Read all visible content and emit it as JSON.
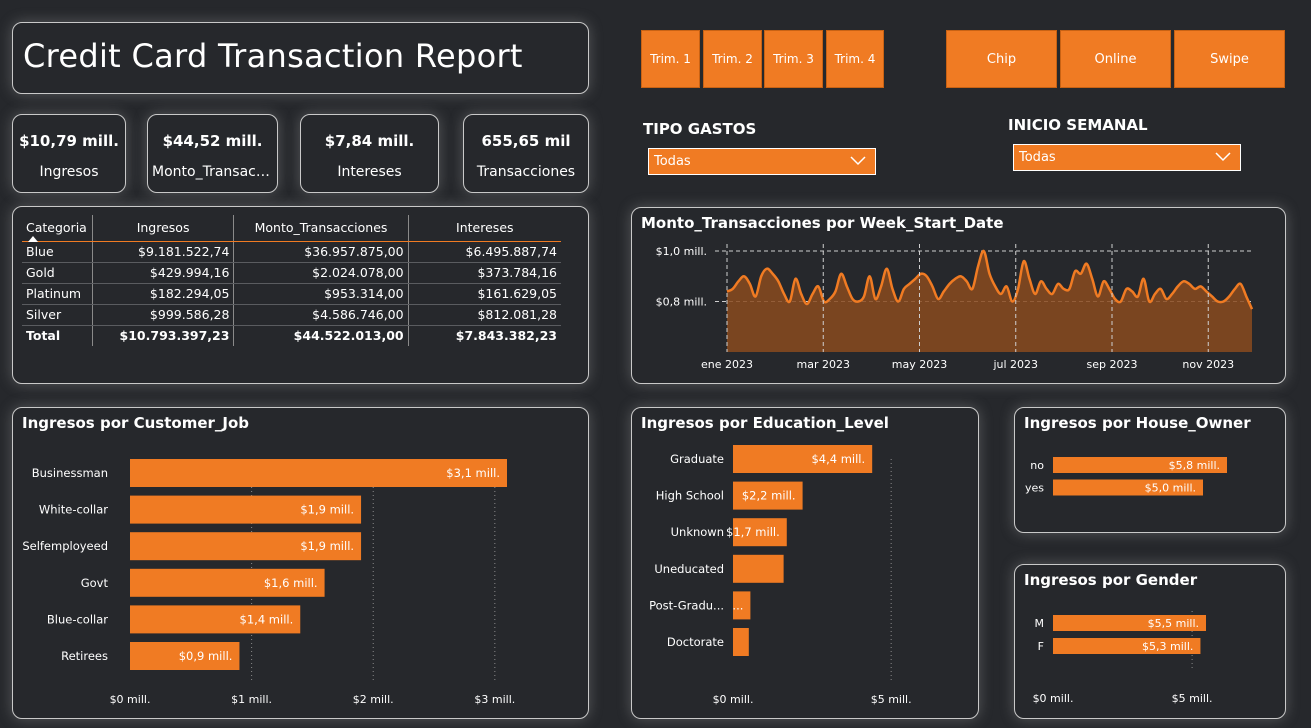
{
  "title": "Credit Card Transaction Report",
  "kpis": [
    {
      "value": "$10,79 mill.",
      "label": "Ingresos"
    },
    {
      "value": "$44,52 mill.",
      "label": "Monto_Transacciones"
    },
    {
      "value": "$7,84 mill.",
      "label": "Intereses"
    },
    {
      "value": "655,65 mil",
      "label": "Transacciones"
    }
  ],
  "quarter_buttons": [
    "Trim. 1",
    "Trim. 2",
    "Trim. 3",
    "Trim. 4"
  ],
  "channel_buttons": [
    "Chip",
    "Online",
    "Swipe"
  ],
  "accent": "#f07b23",
  "slicers": {
    "tipo_gastos": {
      "label": "TIPO GASTOS",
      "value": "Todas"
    },
    "inicio_semanal": {
      "label": "INICIO SEMANAL",
      "value": "Todas"
    }
  },
  "table": {
    "headers": [
      "Categoria",
      "Ingresos",
      "Monto_Transacciones",
      "Intereses"
    ],
    "rows": [
      [
        "Blue",
        "$9.181.522,74",
        "$36.957.875,00",
        "$6.495.887,74"
      ],
      [
        "Gold",
        "$429.994,16",
        "$2.024.078,00",
        "$373.784,16"
      ],
      [
        "Platinum",
        "$182.294,05",
        "$953.314,00",
        "$161.629,05"
      ],
      [
        "Silver",
        "$999.586,28",
        "$4.586.746,00",
        "$812.081,28"
      ]
    ],
    "total": [
      "Total",
      "$10.793.397,23",
      "$44.522.013,00",
      "$7.843.382,23"
    ]
  },
  "chart_data": [
    {
      "id": "weekly",
      "type": "area",
      "title": "Monto_Transacciones por Week_Start_Date",
      "y_ticks": [
        "$1,0 mill.",
        "$0,8 mill."
      ],
      "y_tick_values": [
        1.0,
        0.8
      ],
      "ylim": [
        0.6,
        1.02
      ],
      "x_ticks": [
        "ene 2023",
        "mar 2023",
        "may 2023",
        "jul 2023",
        "sep 2023",
        "nov 2023"
      ],
      "values": [
        0.84,
        0.85,
        0.88,
        0.9,
        0.87,
        0.82,
        0.9,
        0.93,
        0.91,
        0.88,
        0.83,
        0.8,
        0.89,
        0.83,
        0.79,
        0.83,
        0.86,
        0.8,
        0.81,
        0.84,
        0.91,
        0.86,
        0.81,
        0.8,
        0.82,
        0.9,
        0.81,
        0.86,
        0.93,
        0.85,
        0.8,
        0.85,
        0.87,
        0.89,
        0.91,
        0.9,
        0.86,
        0.81,
        0.84,
        0.87,
        0.89,
        0.9,
        0.88,
        0.85,
        0.94,
        1.0,
        0.91,
        0.86,
        0.83,
        0.86,
        0.8,
        0.85,
        0.96,
        0.89,
        0.83,
        0.88,
        0.85,
        0.83,
        0.87,
        0.85,
        0.85,
        0.92,
        0.91,
        0.95,
        0.89,
        0.82,
        0.88,
        0.85,
        0.81,
        0.8,
        0.85,
        0.84,
        0.82,
        0.89,
        0.8,
        0.83,
        0.85,
        0.81,
        0.83,
        0.86,
        0.88,
        0.87,
        0.85,
        0.86,
        0.84,
        0.82,
        0.8,
        0.8,
        0.82,
        0.85,
        0.87,
        0.82,
        0.77
      ]
    },
    {
      "id": "job",
      "type": "bar",
      "title": "Ingresos por Customer_Job",
      "categories": [
        "Businessman",
        "White-collar",
        "Selfemployeed",
        "Govt",
        "Blue-collar",
        "Retirees"
      ],
      "values": [
        3.1,
        1.9,
        1.9,
        1.6,
        1.4,
        0.9
      ],
      "labels": [
        "$3,1 mill.",
        "$1,9 mill.",
        "$1,9 mill.",
        "$1,6 mill.",
        "$1,4 mill.",
        "$0,9 mill."
      ],
      "x_ticks": [
        "$0 mill.",
        "$1 mill.",
        "$2 mill.",
        "$3 mill."
      ],
      "x_tick_values": [
        0,
        1,
        2,
        3
      ],
      "xlim": [
        0,
        3.1
      ]
    },
    {
      "id": "education",
      "type": "bar",
      "title": "Ingresos por Education_Level",
      "categories": [
        "Graduate",
        "High School",
        "Unknown",
        "Uneducated",
        "Post-Gradu...",
        "Doctorate"
      ],
      "values": [
        4.4,
        2.2,
        1.7,
        1.6,
        0.55,
        0.5
      ],
      "labels": [
        "$4,4 mill.",
        "$2,2 mill.",
        "$1,7 mill.",
        "",
        "...",
        ""
      ],
      "x_ticks": [
        "$0 mill.",
        "$5 mill."
      ],
      "x_tick_values": [
        0,
        5
      ],
      "xlim": [
        0,
        4.9
      ]
    },
    {
      "id": "house",
      "type": "bar",
      "title": "Ingresos por House_Owner",
      "categories": [
        "no",
        "yes"
      ],
      "values": [
        5.8,
        5.0
      ],
      "labels": [
        "$5,8 mill.",
        "$5,0 mill."
      ],
      "x_ticks": [],
      "x_tick_values": [],
      "xlim": [
        0,
        5.8
      ]
    },
    {
      "id": "gender",
      "type": "bar",
      "title": "Ingresos por Gender",
      "categories": [
        "M",
        "F"
      ],
      "values": [
        5.5,
        5.3
      ],
      "labels": [
        "$5,5 mill.",
        "$5,3 mill."
      ],
      "x_ticks": [
        "$0 mill.",
        "$5 mill."
      ],
      "x_tick_values": [
        0,
        5
      ],
      "xlim": [
        0,
        5.5
      ]
    }
  ]
}
